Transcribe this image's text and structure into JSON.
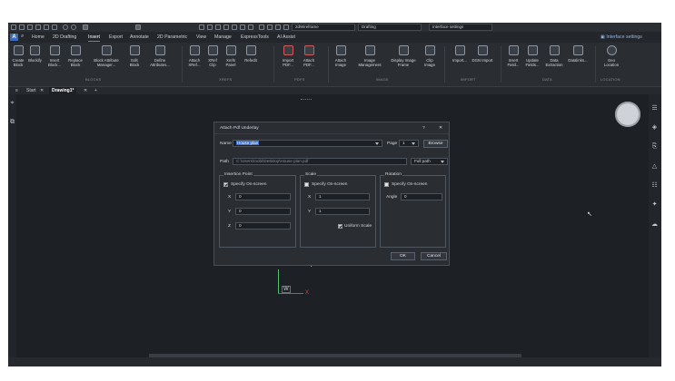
{
  "quick_access": {
    "workspace_value": "2dWireframe",
    "drafting_value": "Drafting",
    "interface_settings_value": "Interface settings"
  },
  "menu": {
    "app_letter": "A",
    "tabs": [
      "Home",
      "2D Drafting",
      "Insert",
      "Export",
      "Annotate",
      "2D Parametric",
      "View",
      "Manage",
      "ExpressTools",
      "AI Assist"
    ],
    "active_tab": "Insert",
    "interface_settings": "Interface settings"
  },
  "ribbon": {
    "blocks": [
      "Create Block",
      "Blockify",
      "Insert Block...",
      "Replace Block",
      "Block Attribute Manager...",
      "Edit Block",
      "Define Attributes..."
    ],
    "xrefs": [
      "Attach XRef...",
      "XRef Clip",
      "Xrefs Panel",
      "Refedit"
    ],
    "pdfs": [
      "Import PDF...",
      "Attach PDF..."
    ],
    "images": [
      "Attach Image",
      "Image Management",
      "Display Image Frame",
      "Clip Image"
    ],
    "import": [
      "Import...",
      "DGN Import"
    ],
    "data": [
      "Insert Field...",
      "Update Fields...",
      "Data Extraction",
      "Datalinks..."
    ],
    "location": [
      "Geo Location"
    ],
    "group_labels": [
      "BLOCKS",
      "XREFS",
      "PDFS",
      "IMAGE",
      "IMPORT",
      "DATA",
      "LOCATION"
    ]
  },
  "doc_tabs": {
    "start": "Start",
    "drawing": "Drawing1*",
    "add": "+"
  },
  "ucs": {
    "x": "X",
    "y": "Y",
    "w": "W"
  },
  "dialog": {
    "title": "Attach Pdf Underlay",
    "help": "?",
    "close": "✕",
    "name_label": "Name",
    "name_value": "House plan",
    "page_label": "Page",
    "page_value": "1",
    "browse": "Browse",
    "path_label": "Path",
    "path_value": "C:\\Users\\mobi\\Desktop\\House plan.pdf",
    "path_mode": "Full path",
    "insertion": {
      "legend": "Insertion Point",
      "specify": "Specify On-screen",
      "specify_checked": true,
      "x_label": "X",
      "x_value": "0",
      "y_label": "Y",
      "y_value": "0",
      "z_label": "Z",
      "z_value": "0"
    },
    "scale": {
      "legend": "Scale",
      "specify": "Specify On-screen",
      "specify_checked": false,
      "x_label": "X",
      "x_value": "1",
      "y_label": "Y",
      "y_value": "1",
      "uniform": "Uniform Scale",
      "uniform_checked": true
    },
    "rotation": {
      "legend": "Rotation",
      "specify": "Specify On-screen",
      "specify_checked": false,
      "angle_label": "Angle",
      "angle_value": "0"
    },
    "ok": "OK",
    "cancel": "Cancel"
  },
  "colors": {
    "accent": "#4a8be0",
    "background": "#1d2024",
    "dialog": "#2a2d31",
    "axis_red": "#d04848"
  }
}
